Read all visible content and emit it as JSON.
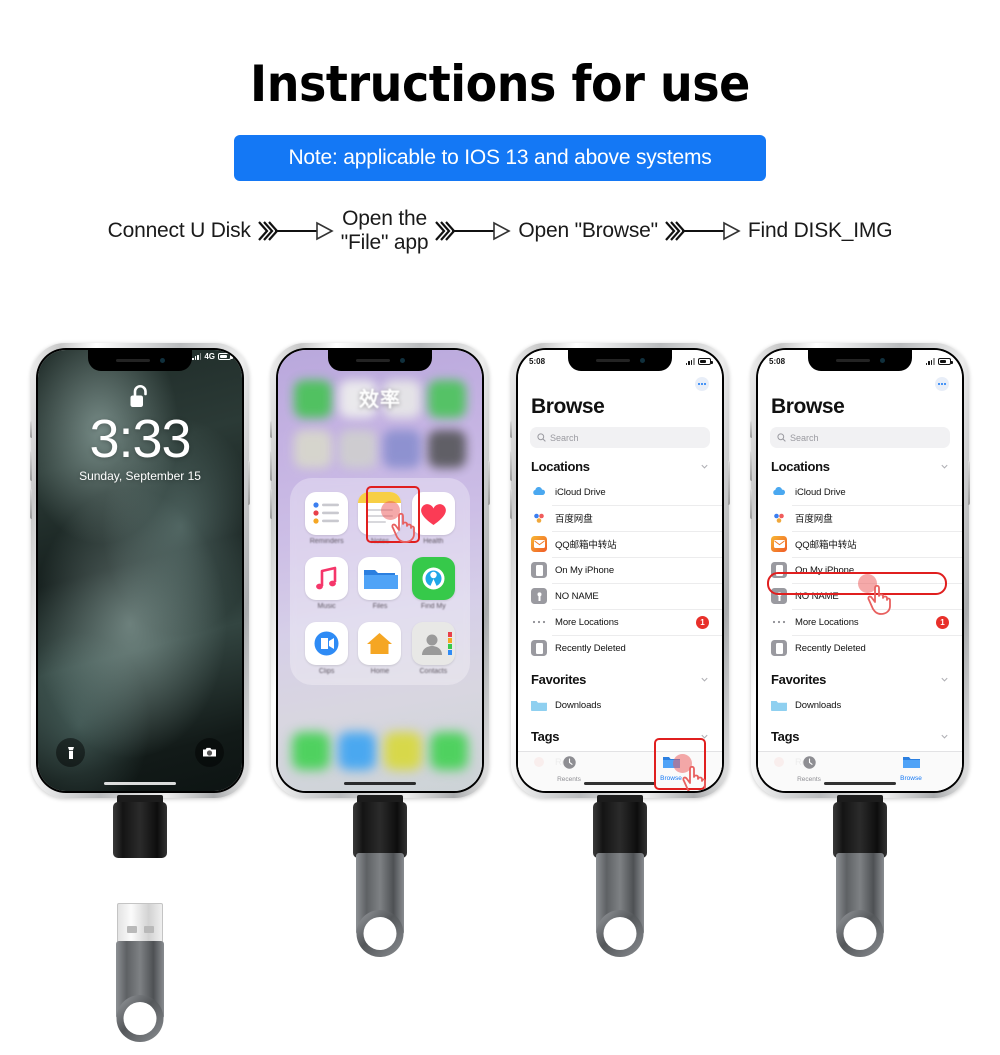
{
  "header": {
    "title": "Instructions for use",
    "note": "Note: applicable to IOS 13 and above systems",
    "note_bg": "#1478f5"
  },
  "steps": [
    {
      "label": "Connect U Disk"
    },
    {
      "label": "Open the\n\"File\" app"
    },
    {
      "label": "Open \"Browse\""
    },
    {
      "label": "Find DISK_IMG"
    }
  ],
  "phones": [
    {
      "id": "phone-lockscreen",
      "type": "lockscreen",
      "status": {
        "signal": "4G"
      },
      "lock_icon": "unlocked-padlock-icon",
      "time": "3:33",
      "date": "Sunday, September 15",
      "actions": [
        {
          "name": "flashlight-icon"
        },
        {
          "name": "camera-icon"
        }
      ],
      "usb": {
        "attached": false
      }
    },
    {
      "id": "phone-homescreen",
      "type": "homescreen",
      "folder_title": "效率",
      "apps": [
        {
          "label": "Reminders",
          "icon": "reminders-icon",
          "highlighted": false
        },
        {
          "label": "Notes",
          "icon": "notes-icon",
          "highlighted": false
        },
        {
          "label": "Health",
          "icon": "health-icon",
          "highlighted": false
        },
        {
          "label": "Music",
          "icon": "music-icon",
          "highlighted": false
        },
        {
          "label": "Files",
          "icon": "files-icon",
          "highlighted": true
        },
        {
          "label": "Find My",
          "icon": "findmy-icon",
          "highlighted": false
        },
        {
          "label": "Clips",
          "icon": "clips-icon",
          "highlighted": false
        },
        {
          "label": "Home",
          "icon": "home-icon",
          "highlighted": false
        },
        {
          "label": "Contacts",
          "icon": "contacts-icon",
          "highlighted": false
        }
      ],
      "usb": {
        "attached": true
      }
    },
    {
      "id": "phone-browse-tab",
      "type": "files",
      "status": {
        "time": "5:08"
      },
      "title": "Browse",
      "search_placeholder": "Search",
      "sections": [
        {
          "title": "Locations",
          "rows": [
            {
              "label": "iCloud Drive",
              "icon": "icloud-icon"
            },
            {
              "label": "百度网盘",
              "icon": "baidu-netdisk-icon"
            },
            {
              "label": "QQ邮箱中转站",
              "icon": "qq-mail-icon"
            },
            {
              "label": "On My iPhone",
              "icon": "iphone-icon"
            },
            {
              "label": "NO NAME",
              "icon": "external-drive-icon"
            },
            {
              "label": "More Locations",
              "icon": "ellipsis-icon",
              "badge": "1"
            },
            {
              "label": "Recently Deleted",
              "icon": "trash-iphone-icon"
            }
          ]
        },
        {
          "title": "Favorites",
          "rows": [
            {
              "label": "Downloads",
              "icon": "folder-icon"
            }
          ]
        },
        {
          "title": "Tags",
          "rows": [
            {
              "label": "Red",
              "icon": "red-tag-icon"
            }
          ]
        }
      ],
      "tabs": [
        {
          "label": "Recents",
          "icon": "clock-icon",
          "active": false
        },
        {
          "label": "Browse",
          "icon": "folder-icon",
          "active": true
        }
      ],
      "highlight": "browse-tab",
      "usb": {
        "attached": true
      }
    },
    {
      "id": "phone-no-name",
      "type": "files",
      "status": {
        "time": "5:08"
      },
      "title": "Browse",
      "search_placeholder": "Search",
      "sections": [
        {
          "title": "Locations",
          "rows": [
            {
              "label": "iCloud Drive",
              "icon": "icloud-icon"
            },
            {
              "label": "百度网盘",
              "icon": "baidu-netdisk-icon"
            },
            {
              "label": "QQ邮箱中转站",
              "icon": "qq-mail-icon"
            },
            {
              "label": "On My iPhone",
              "icon": "iphone-icon"
            },
            {
              "label": "NO NAME",
              "icon": "external-drive-icon"
            },
            {
              "label": "More Locations",
              "icon": "ellipsis-icon",
              "badge": "1"
            },
            {
              "label": "Recently Deleted",
              "icon": "trash-iphone-icon"
            }
          ]
        },
        {
          "title": "Favorites",
          "rows": [
            {
              "label": "Downloads",
              "icon": "folder-icon"
            }
          ]
        },
        {
          "title": "Tags",
          "rows": [
            {
              "label": "Red",
              "icon": "red-tag-icon"
            }
          ]
        }
      ],
      "tabs": [
        {
          "label": "Recents",
          "icon": "clock-icon",
          "active": false
        },
        {
          "label": "Browse",
          "icon": "folder-icon",
          "active": true
        }
      ],
      "highlight": "no-name-row",
      "usb": {
        "attached": true
      }
    }
  ]
}
